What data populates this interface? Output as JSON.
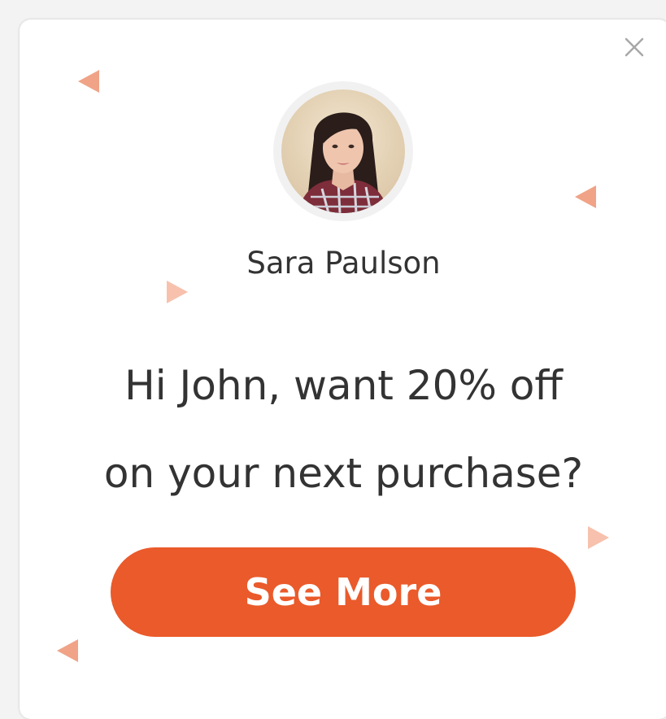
{
  "popup": {
    "sender_name": "Sara Paulson",
    "message_line1": "Hi John, want 20% off",
    "message_line2": "on your next purchase?",
    "cta_label": "See More",
    "close_icon": "close-icon",
    "accent_color": "#ea5a2b"
  }
}
